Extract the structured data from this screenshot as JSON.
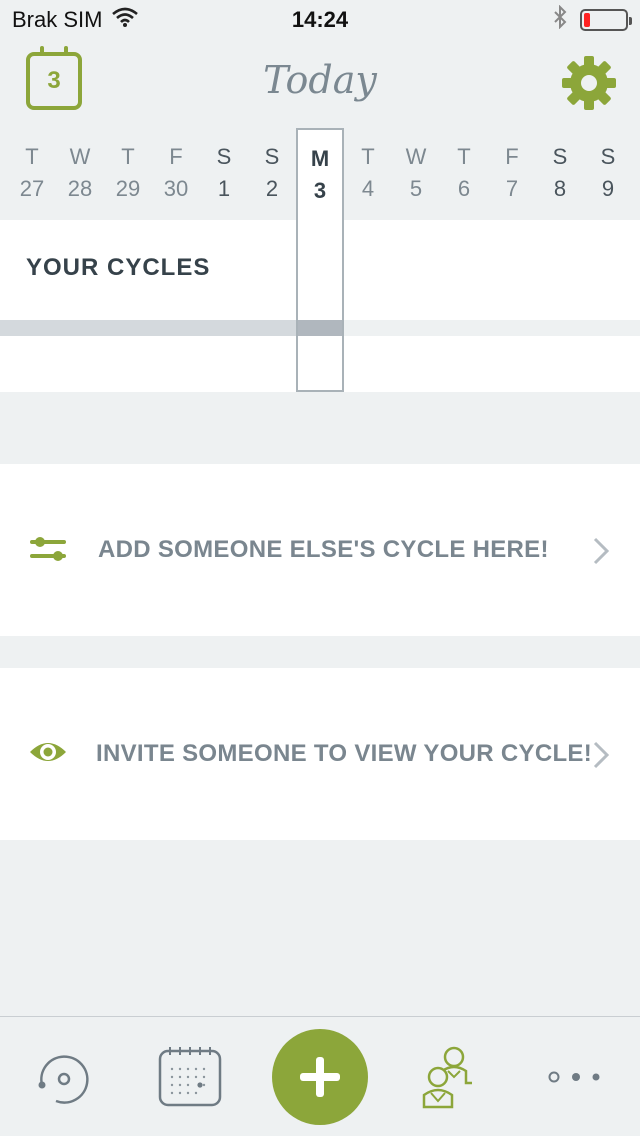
{
  "status_bar": {
    "carrier": "Brak SIM",
    "time": "14:24",
    "battery_level": 0.15
  },
  "header": {
    "calendar_day": "3",
    "title": "Today"
  },
  "week": [
    {
      "letter": "T",
      "num": "27",
      "style": "past"
    },
    {
      "letter": "W",
      "num": "28",
      "style": "past"
    },
    {
      "letter": "T",
      "num": "29",
      "style": "past"
    },
    {
      "letter": "F",
      "num": "30",
      "style": "past"
    },
    {
      "letter": "S",
      "num": "1",
      "style": "weekend"
    },
    {
      "letter": "S",
      "num": "2",
      "style": "weekend"
    },
    {
      "letter": "M",
      "num": "3",
      "style": "today"
    },
    {
      "letter": "T",
      "num": "4",
      "style": "future"
    },
    {
      "letter": "W",
      "num": "5",
      "style": "future"
    },
    {
      "letter": "T",
      "num": "6",
      "style": "future"
    },
    {
      "letter": "F",
      "num": "7",
      "style": "future"
    },
    {
      "letter": "S",
      "num": "8",
      "style": "weekend"
    },
    {
      "letter": "S",
      "num": "9",
      "style": "weekend"
    }
  ],
  "cycles": {
    "title": "YOUR CYCLES"
  },
  "actions": {
    "add_label": "ADD SOMEONE ELSE'S CYCLE HERE!",
    "invite_label": "INVITE SOMEONE TO VIEW YOUR CYCLE!"
  },
  "icons": {
    "calendar": "calendar-icon",
    "settings": "gear-icon",
    "add_cycle": "sliders-icon",
    "invite": "eye-icon",
    "chevron": "chevron-right-icon",
    "tab_cycle": "cycle-ring-icon",
    "tab_calendar": "calendar-grid-icon",
    "tab_add": "plus-icon",
    "tab_partners": "people-icon",
    "tab_more": "more-dots-icon"
  },
  "colors": {
    "accent": "#8ca63a",
    "muted_text": "#7a868f",
    "background": "#eef1f2"
  }
}
